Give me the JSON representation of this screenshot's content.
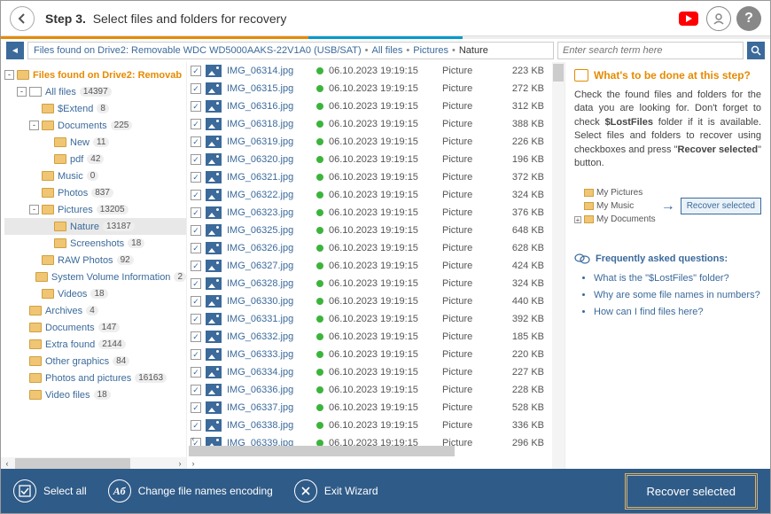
{
  "header": {
    "step_label": "Step 3.",
    "step_title": "Select files and folders for recovery"
  },
  "breadcrumb": {
    "root": "Files found on Drive2: Removable WDC WD5000AAKS-22V1A0 (USB/SAT)",
    "parts": [
      "All files",
      "Pictures",
      "Nature"
    ]
  },
  "search": {
    "placeholder": "Enter search term here"
  },
  "tree": [
    {
      "indent": 0,
      "exp": "-",
      "icon": "root",
      "label": "Files found on Drive2: Removab",
      "count": null,
      "root": true
    },
    {
      "indent": 1,
      "exp": "-",
      "icon": "all",
      "label": "All files",
      "count": "14397"
    },
    {
      "indent": 2,
      "exp": " ",
      "icon": "folder",
      "label": "$Extend",
      "count": "8"
    },
    {
      "indent": 2,
      "exp": "-",
      "icon": "folder",
      "label": "Documents",
      "count": "225"
    },
    {
      "indent": 3,
      "exp": " ",
      "icon": "folder",
      "label": "New",
      "count": "11"
    },
    {
      "indent": 3,
      "exp": " ",
      "icon": "folder",
      "label": "pdf",
      "count": "42"
    },
    {
      "indent": 2,
      "exp": " ",
      "icon": "folder",
      "label": "Music",
      "count": "0"
    },
    {
      "indent": 2,
      "exp": " ",
      "icon": "folder",
      "label": "Photos",
      "count": "837"
    },
    {
      "indent": 2,
      "exp": "-",
      "icon": "folder",
      "label": "Pictures",
      "count": "13205"
    },
    {
      "indent": 3,
      "exp": " ",
      "icon": "folder",
      "label": "Nature",
      "count": "13187",
      "selected": true
    },
    {
      "indent": 3,
      "exp": " ",
      "icon": "folder",
      "label": "Screenshots",
      "count": "18"
    },
    {
      "indent": 2,
      "exp": " ",
      "icon": "folder",
      "label": "RAW Photos",
      "count": "92"
    },
    {
      "indent": 2,
      "exp": " ",
      "icon": "folder",
      "label": "System Volume Information",
      "count": "2"
    },
    {
      "indent": 2,
      "exp": " ",
      "icon": "folder",
      "label": "Videos",
      "count": "18"
    },
    {
      "indent": 1,
      "exp": " ",
      "icon": "folder",
      "label": "Archives",
      "count": "4"
    },
    {
      "indent": 1,
      "exp": " ",
      "icon": "folder",
      "label": "Documents",
      "count": "147"
    },
    {
      "indent": 1,
      "exp": " ",
      "icon": "folder",
      "label": "Extra found",
      "count": "2144"
    },
    {
      "indent": 1,
      "exp": " ",
      "icon": "folder",
      "label": "Other graphics",
      "count": "84"
    },
    {
      "indent": 1,
      "exp": " ",
      "icon": "folder",
      "label": "Photos and pictures",
      "count": "16163"
    },
    {
      "indent": 1,
      "exp": " ",
      "icon": "folder",
      "label": "Video files",
      "count": "18"
    }
  ],
  "files": [
    {
      "name": "IMG_06314.jpg",
      "date": "06.10.2023 19:19:15",
      "type": "Picture",
      "size": "223 KB"
    },
    {
      "name": "IMG_06315.jpg",
      "date": "06.10.2023 19:19:15",
      "type": "Picture",
      "size": "272 KB"
    },
    {
      "name": "IMG_06316.jpg",
      "date": "06.10.2023 19:19:15",
      "type": "Picture",
      "size": "312 KB"
    },
    {
      "name": "IMG_06318.jpg",
      "date": "06.10.2023 19:19:15",
      "type": "Picture",
      "size": "388 KB"
    },
    {
      "name": "IMG_06319.jpg",
      "date": "06.10.2023 19:19:15",
      "type": "Picture",
      "size": "226 KB"
    },
    {
      "name": "IMG_06320.jpg",
      "date": "06.10.2023 19:19:15",
      "type": "Picture",
      "size": "196 KB"
    },
    {
      "name": "IMG_06321.jpg",
      "date": "06.10.2023 19:19:15",
      "type": "Picture",
      "size": "372 KB"
    },
    {
      "name": "IMG_06322.jpg",
      "date": "06.10.2023 19:19:15",
      "type": "Picture",
      "size": "324 KB"
    },
    {
      "name": "IMG_06323.jpg",
      "date": "06.10.2023 19:19:15",
      "type": "Picture",
      "size": "376 KB"
    },
    {
      "name": "IMG_06325.jpg",
      "date": "06.10.2023 19:19:15",
      "type": "Picture",
      "size": "648 KB"
    },
    {
      "name": "IMG_06326.jpg",
      "date": "06.10.2023 19:19:15",
      "type": "Picture",
      "size": "628 KB"
    },
    {
      "name": "IMG_06327.jpg",
      "date": "06.10.2023 19:19:15",
      "type": "Picture",
      "size": "424 KB"
    },
    {
      "name": "IMG_06328.jpg",
      "date": "06.10.2023 19:19:15",
      "type": "Picture",
      "size": "324 KB"
    },
    {
      "name": "IMG_06330.jpg",
      "date": "06.10.2023 19:19:15",
      "type": "Picture",
      "size": "440 KB"
    },
    {
      "name": "IMG_06331.jpg",
      "date": "06.10.2023 19:19:15",
      "type": "Picture",
      "size": "392 KB"
    },
    {
      "name": "IMG_06332.jpg",
      "date": "06.10.2023 19:19:15",
      "type": "Picture",
      "size": "185 KB"
    },
    {
      "name": "IMG_06333.jpg",
      "date": "06.10.2023 19:19:15",
      "type": "Picture",
      "size": "220 KB"
    },
    {
      "name": "IMG_06334.jpg",
      "date": "06.10.2023 19:19:15",
      "type": "Picture",
      "size": "227 KB"
    },
    {
      "name": "IMG_06336.jpg",
      "date": "06.10.2023 19:19:15",
      "type": "Picture",
      "size": "228 KB"
    },
    {
      "name": "IMG_06337.jpg",
      "date": "06.10.2023 19:19:15",
      "type": "Picture",
      "size": "528 KB"
    },
    {
      "name": "IMG_06338.jpg",
      "date": "06.10.2023 19:19:15",
      "type": "Picture",
      "size": "336 KB"
    },
    {
      "name": "IMG_06339.jpg",
      "date": "06.10.2023 19:19:15",
      "type": "Picture",
      "size": "296 KB"
    }
  ],
  "aside": {
    "heading": "What's to be done at this step?",
    "body_parts": [
      "Check the found files and folders for the data you are looking for. Don't forget to check ",
      "$LostFiles",
      " folder if it is available. Select files and folders to recover using checkboxes and press \"",
      "Recover selected",
      "\" button."
    ],
    "diagram": {
      "items": [
        "My Pictures",
        "My Music",
        "My Documents"
      ],
      "button": "Recover selected"
    },
    "faq_heading": "Frequently asked questions:",
    "faq": [
      "What is the \"$LostFiles\" folder?",
      "Why are some file names in numbers?",
      "How can I find files here?"
    ]
  },
  "footer": {
    "select_all": "Select all",
    "encoding": "Change file names encoding",
    "exit": "Exit Wizard",
    "recover": "Recover selected"
  }
}
